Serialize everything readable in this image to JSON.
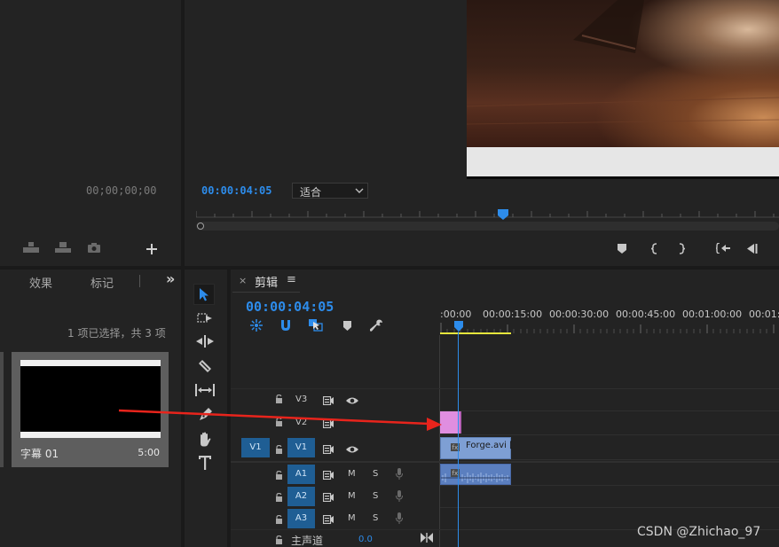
{
  "source_monitor": {
    "timecode": "00;00;00;00"
  },
  "program_monitor": {
    "timecode": "00:00:04:05",
    "zoom_select": "适合"
  },
  "project_panel": {
    "tabs": [
      "效果",
      "标记"
    ],
    "overflow": "»",
    "status": "1 项已选择，共 3 项",
    "item": {
      "name": "字幕 01",
      "duration": "5:00"
    }
  },
  "timeline": {
    "close": "×",
    "title": "剪辑",
    "menu": "≡",
    "timecode": "00:00:04:05",
    "ruler": [
      ":00:00",
      "00:00:15:00",
      "00:00:30:00",
      "00:00:45:00",
      "00:01:00:00",
      "00:01:1"
    ],
    "video_tracks": [
      {
        "name": "V3",
        "source": ""
      },
      {
        "name": "V2",
        "source": ""
      },
      {
        "name": "V1",
        "source": "V1"
      }
    ],
    "audio_tracks": [
      {
        "name": "A1",
        "m": "M",
        "s": "S"
      },
      {
        "name": "A2",
        "m": "M",
        "s": "S"
      },
      {
        "name": "A3",
        "m": "M",
        "s": "S"
      }
    ],
    "master": {
      "label": "主声道",
      "value": "0.0"
    },
    "clips": {
      "video_clip": "Forge.avi [",
      "video_clip_display": "Forge.avi ["
    }
  },
  "watermark": "CSDN @Zhichao_97",
  "colors": {
    "accent_blue": "#2d8ceb",
    "title_clip": "#e08ee0",
    "video_clip": "#7e9fd4",
    "audio_clip": "#5b7fbf",
    "track_target": "#1f5e94",
    "arrow": "#e8241c",
    "work_area": "#e6e63c"
  }
}
